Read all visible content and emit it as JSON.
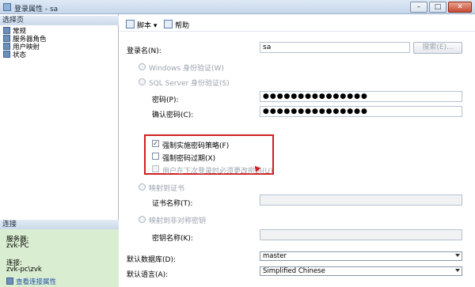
{
  "window": {
    "title": "登录属性 - sa",
    "min": "–",
    "max": "□",
    "close": "✕"
  },
  "left": {
    "select_page": "选择页",
    "nav": [
      "常规",
      "服务器角色",
      "用户映射",
      "状态"
    ],
    "connection_head": "连接",
    "server_label": "服务器:",
    "server_value": "zvk-PC",
    "conn_label": "连接:",
    "conn_value": "zvk-pc\\zvk",
    "view_link": "查看连接属性"
  },
  "toolbar": {
    "script": "脚本",
    "help": "帮助"
  },
  "form": {
    "login_name_label": "登录名(N):",
    "login_name_value": "sa",
    "search_button": "搜索(E)...",
    "windows_auth": "Windows 身份验证(W)",
    "sql_auth": "SQL Server 身份验证(S)",
    "password_label": "密码(P):",
    "password_value": "●●●●●●●●●●●●●●●",
    "confirm_label": "确认密码(C):",
    "confirm_value": "●●●●●●●●●●●●●●●",
    "enforce_policy": "强制实施密码策略(F)",
    "enforce_expiration": "强制密码过期(X)",
    "must_change": "用户在下次登录时必须更改密码(U)",
    "map_cert": "映射到证书",
    "cert_name_label": "证书名称(T):",
    "map_key": "映射到非对称密钥",
    "key_name_label": "密钥名称(K):",
    "default_db_label": "默认数据库(D):",
    "default_db_value": "master",
    "default_lang_label": "默认语言(A):",
    "default_lang_value": "Simplified Chinese"
  },
  "colors": {
    "accent_red": "#d21f1f"
  }
}
